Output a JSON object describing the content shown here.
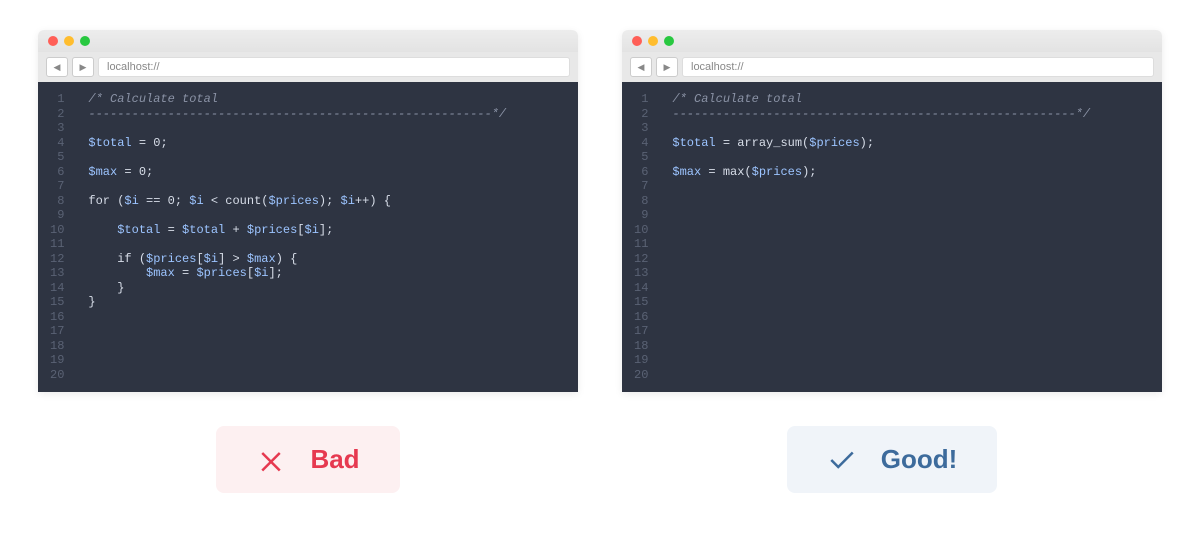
{
  "left": {
    "url": "localhost://",
    "line_count": 20,
    "code_tokens": [
      [
        {
          "t": "comment",
          "s": "/* Calculate total"
        }
      ],
      [
        {
          "t": "comment",
          "s": "--------------------------------------------------------*/"
        }
      ],
      [],
      [
        {
          "t": "var",
          "s": "$total"
        },
        {
          "t": "op",
          "s": " = "
        },
        {
          "t": "num",
          "s": "0"
        },
        {
          "t": "punc",
          "s": ";"
        }
      ],
      [],
      [
        {
          "t": "var",
          "s": "$max"
        },
        {
          "t": "op",
          "s": " = "
        },
        {
          "t": "num",
          "s": "0"
        },
        {
          "t": "punc",
          "s": ";"
        }
      ],
      [],
      [
        {
          "t": "kw",
          "s": "for ("
        },
        {
          "t": "var",
          "s": "$i"
        },
        {
          "t": "op",
          "s": " == "
        },
        {
          "t": "num",
          "s": "0"
        },
        {
          "t": "punc",
          "s": "; "
        },
        {
          "t": "var",
          "s": "$i"
        },
        {
          "t": "op",
          "s": " < "
        },
        {
          "t": "func",
          "s": "count("
        },
        {
          "t": "var",
          "s": "$prices"
        },
        {
          "t": "punc",
          "s": "); "
        },
        {
          "t": "var",
          "s": "$i"
        },
        {
          "t": "op",
          "s": "++"
        },
        {
          "t": "punc",
          "s": ") {"
        }
      ],
      [],
      [
        {
          "t": "punc",
          "s": "    "
        },
        {
          "t": "var",
          "s": "$total"
        },
        {
          "t": "op",
          "s": " = "
        },
        {
          "t": "var",
          "s": "$total"
        },
        {
          "t": "op",
          "s": " + "
        },
        {
          "t": "var",
          "s": "$prices"
        },
        {
          "t": "punc",
          "s": "["
        },
        {
          "t": "var",
          "s": "$i"
        },
        {
          "t": "punc",
          "s": "];"
        }
      ],
      [],
      [
        {
          "t": "punc",
          "s": "    "
        },
        {
          "t": "kw",
          "s": "if ("
        },
        {
          "t": "var",
          "s": "$prices"
        },
        {
          "t": "punc",
          "s": "["
        },
        {
          "t": "var",
          "s": "$i"
        },
        {
          "t": "punc",
          "s": "] > "
        },
        {
          "t": "var",
          "s": "$max"
        },
        {
          "t": "punc",
          "s": ") {"
        }
      ],
      [
        {
          "t": "punc",
          "s": "        "
        },
        {
          "t": "var",
          "s": "$max"
        },
        {
          "t": "op",
          "s": " = "
        },
        {
          "t": "var",
          "s": "$prices"
        },
        {
          "t": "punc",
          "s": "["
        },
        {
          "t": "var",
          "s": "$i"
        },
        {
          "t": "punc",
          "s": "];"
        }
      ],
      [
        {
          "t": "punc",
          "s": "    }"
        }
      ],
      [
        {
          "t": "punc",
          "s": "}"
        }
      ],
      [],
      [],
      [],
      [],
      []
    ],
    "badge_label": "Bad"
  },
  "right": {
    "url": "localhost://",
    "line_count": 20,
    "code_tokens": [
      [
        {
          "t": "comment",
          "s": "/* Calculate total"
        }
      ],
      [
        {
          "t": "comment",
          "s": "--------------------------------------------------------*/"
        }
      ],
      [],
      [
        {
          "t": "var",
          "s": "$total"
        },
        {
          "t": "op",
          "s": " = "
        },
        {
          "t": "func",
          "s": "array_sum("
        },
        {
          "t": "var",
          "s": "$prices"
        },
        {
          "t": "punc",
          "s": ");"
        }
      ],
      [],
      [
        {
          "t": "var",
          "s": "$max"
        },
        {
          "t": "op",
          "s": " = "
        },
        {
          "t": "func",
          "s": "max("
        },
        {
          "t": "var",
          "s": "$prices"
        },
        {
          "t": "punc",
          "s": ");"
        }
      ],
      [],
      [],
      [],
      [],
      [],
      [],
      [],
      [],
      [],
      [],
      [],
      [],
      [],
      []
    ],
    "badge_label": "Good!"
  }
}
